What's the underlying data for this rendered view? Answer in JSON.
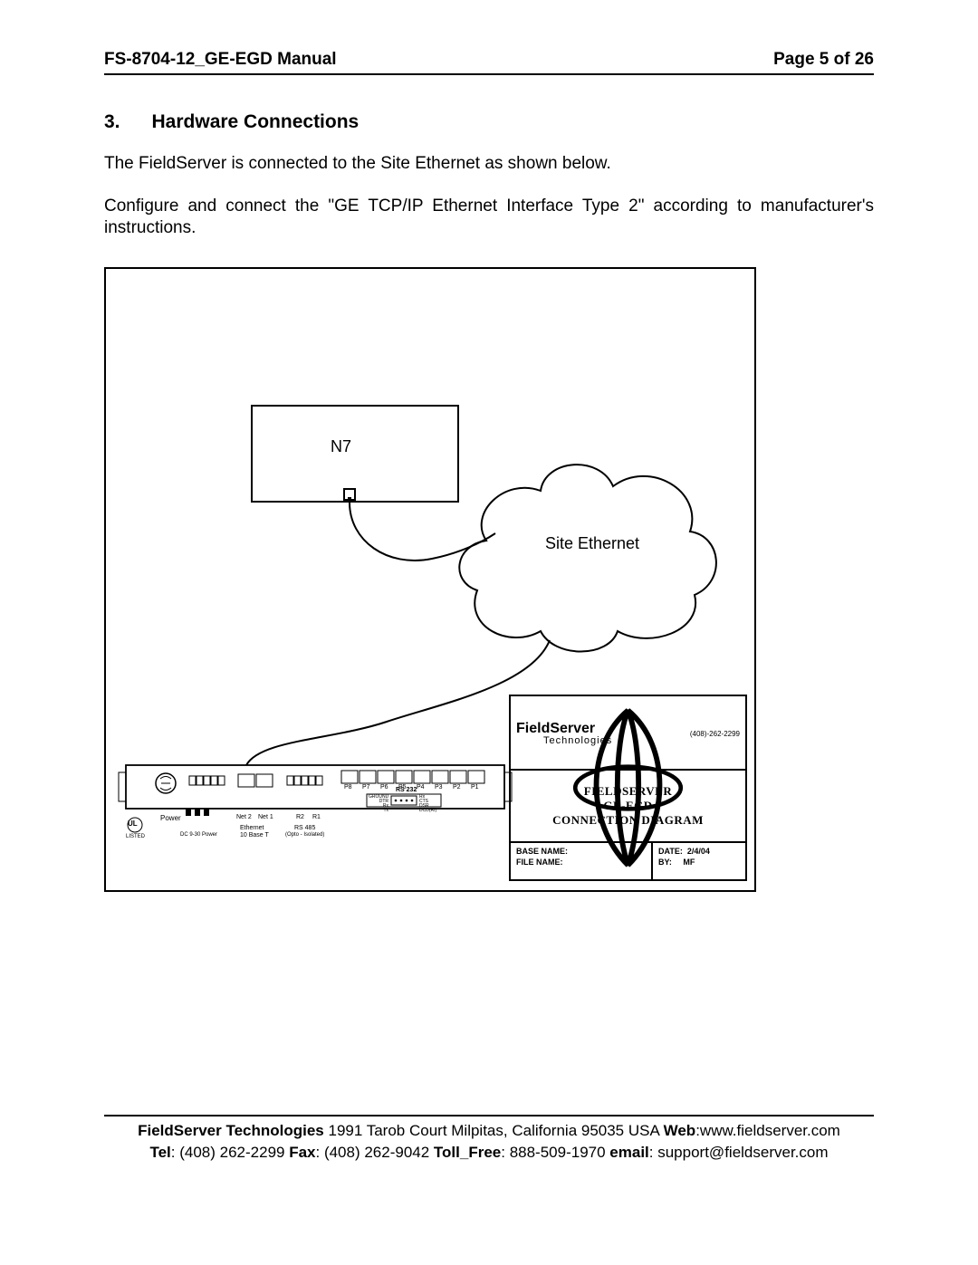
{
  "header": {
    "doc_title": "FS-8704-12_GE-EGD Manual",
    "page_indicator": "Page 5 of 26"
  },
  "section": {
    "number": "3.",
    "title": "Hardware Connections"
  },
  "paragraphs": {
    "p1": "The FieldServer is connected to the Site Ethernet as shown below.",
    "p2": "Configure and connect the \"GE TCP/IP Ethernet Interface Type 2\" according to manufacturer's instructions."
  },
  "diagram": {
    "n7_label": "N7",
    "cloud_label": "Site Ethernet",
    "device": {
      "power_label": "Power",
      "ul_text": "UL",
      "listed_text": "LISTED",
      "netA": "Net 2",
      "netB": "Net 1",
      "eth_label": "Ethernet",
      "eth_sub": "10 Base T",
      "rs485_label": "RS 485",
      "rs485_sub": "(Opto - Isolated)",
      "rs232_label": "RS 232",
      "r_ports": [
        "R2",
        "R1"
      ],
      "p_ports": [
        "P8",
        "P7",
        "P6",
        "P5",
        "P4",
        "P3",
        "P2",
        "P1"
      ],
      "conn_pins_left": [
        "GROUND",
        "DTR",
        "Rx",
        "Tx"
      ],
      "conn_pins_nums_left": [
        "5",
        "4",
        "3",
        "2"
      ],
      "conn_pins_right": [
        "Rx",
        "CTS",
        "DSR",
        "DCD(RI)"
      ],
      "conn_pins_nums_right": [
        "9",
        "8",
        "7",
        "6"
      ],
      "dc_label": "DC 9-30 Power"
    },
    "title_block": {
      "brand": "FieldServer",
      "brand_sub": "Technologies",
      "phone": "(408)-262-2299",
      "line1": "FIELDSERVER",
      "line2": "GE-EGD",
      "line3": "CONNECTION DIAGRAM",
      "base_name_label": "BASE NAME:",
      "file_name_label": "FILE NAME:",
      "date_label": "DATE:",
      "date_value": "2/4/04",
      "by_label": "BY:",
      "by_value": "MF"
    }
  },
  "footer": {
    "company": "FieldServer Technologies",
    "address": " 1991 Tarob Court Milpitas, California 95035 USA ",
    "web_label": " Web",
    "web_value": ":www.fieldserver.com",
    "tel_label": "Tel",
    "tel_value": ": (408) 262-2299   ",
    "fax_label": "Fax",
    "fax_value": ": (408) 262-9042   ",
    "tollfree_label": "Toll_Free",
    "tollfree_value": ": 888-509-1970   ",
    "email_label": "email",
    "email_value": ": support@fieldserver.com"
  }
}
